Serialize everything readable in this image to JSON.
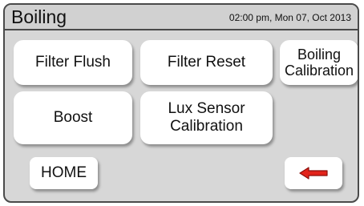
{
  "header": {
    "title": "Boiling",
    "datetime": "02:00 pm, Mon 07, Oct 2013"
  },
  "buttons": {
    "filter_flush": "Filter Flush",
    "filter_reset": "Filter Reset",
    "boiling_calibration": "Boiling\nCalibration",
    "boost": "Boost",
    "lux_sensor_calibration": "Lux Sensor\nCalibration",
    "home": "HOME"
  },
  "icons": {
    "back": "back-arrow-icon"
  },
  "colors": {
    "screen_background": "#d7d7d7",
    "button_background": "#ffffff",
    "arrow_fill": "#e2231a",
    "arrow_outline": "#8a0f0a"
  }
}
